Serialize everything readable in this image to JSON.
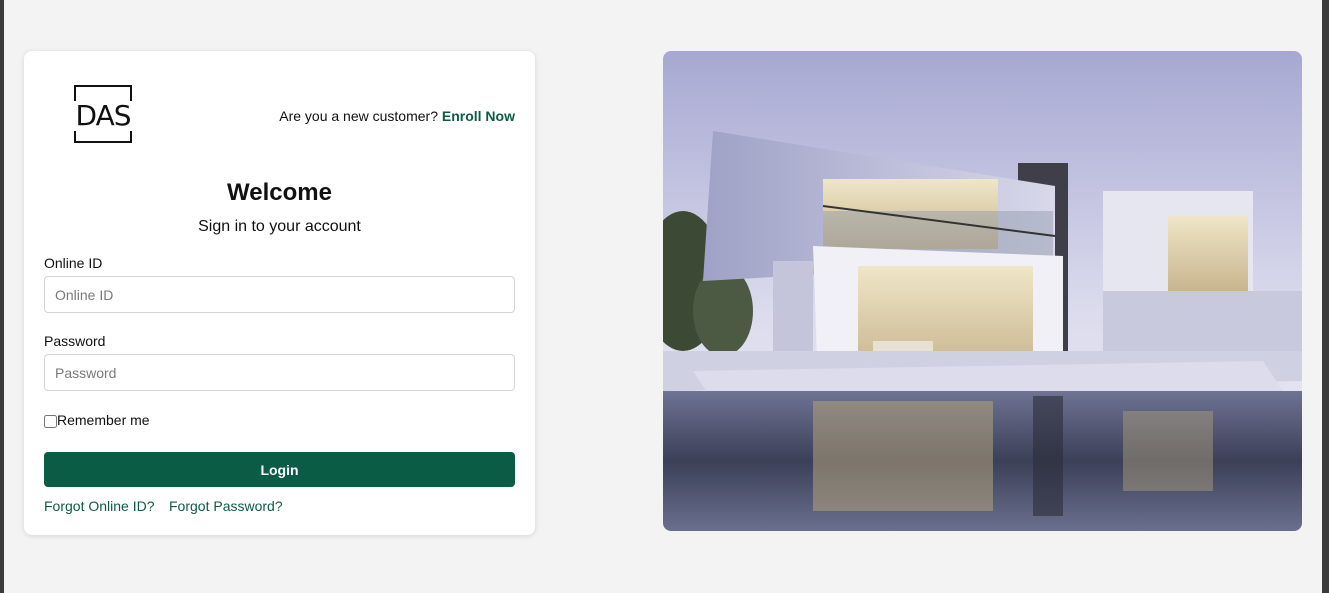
{
  "logo": {
    "text": "DAS"
  },
  "header": {
    "enroll_prompt": "Are you a new customer?",
    "enroll_link": "Enroll Now"
  },
  "form": {
    "title": "Welcome",
    "subtitle": "Sign in to your account",
    "online_id_label": "Online ID",
    "online_id_placeholder": "Online ID",
    "password_label": "Password",
    "password_placeholder": "Password",
    "remember_label": "Remember me",
    "login_button": "Login",
    "forgot_id": "Forgot Online ID?",
    "forgot_password": "Forgot Password?"
  },
  "colors": {
    "brand": "#0b5c45",
    "page_bg": "#f3f3f3",
    "card_bg": "#ffffff"
  },
  "hero_image": {
    "icon": "modern-house-photo"
  }
}
